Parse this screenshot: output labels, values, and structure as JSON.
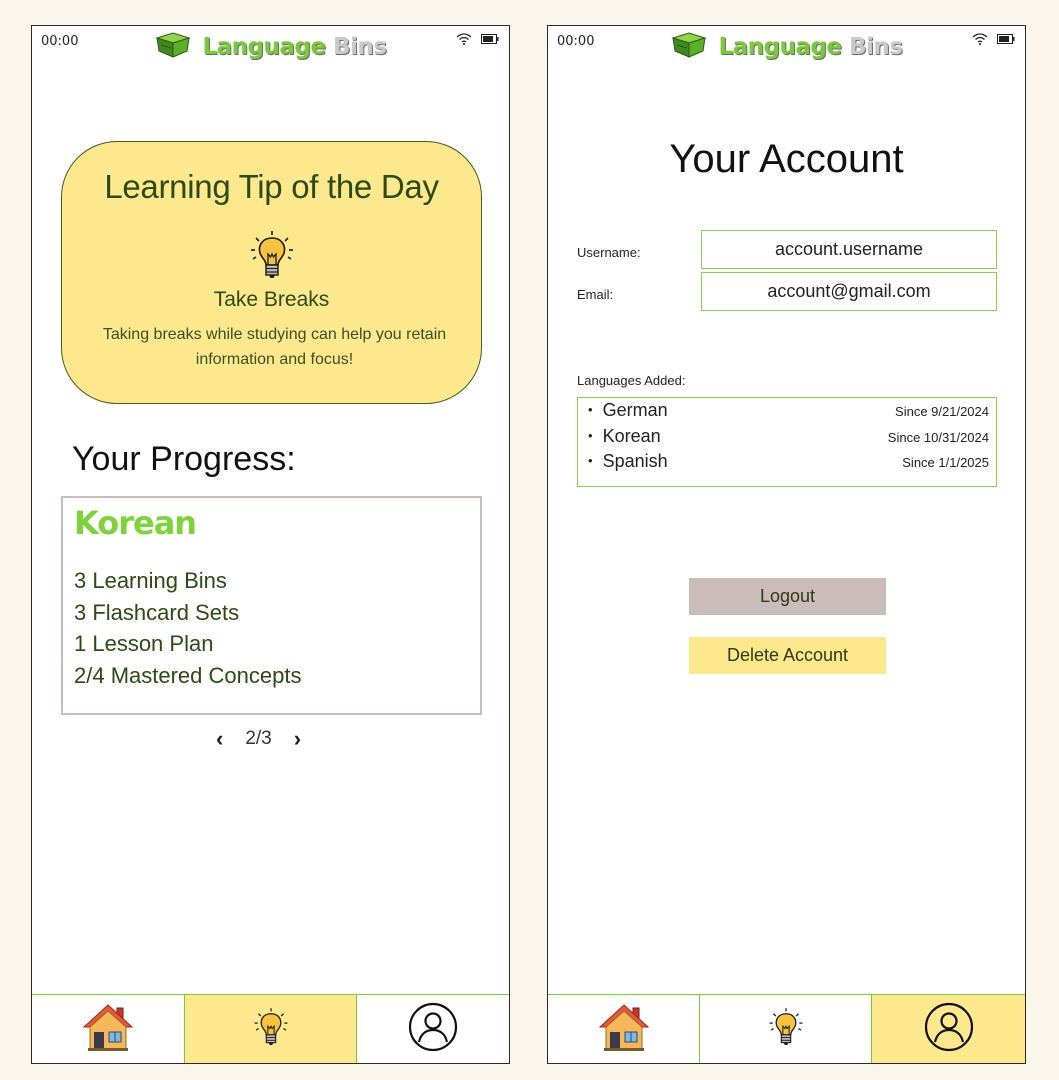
{
  "colors": {
    "brand_green": "#7ac93a",
    "accent_yellow": "#fde88e",
    "muted_rose": "#cbbcbc",
    "background": "#fbf6ec"
  },
  "status_bar": {
    "time": "00:00",
    "icons": [
      "wifi-icon",
      "battery-icon"
    ]
  },
  "brand": {
    "word1": "Language",
    "word2": "Bins",
    "logo_icon": "green-bin-icon"
  },
  "home_screen": {
    "tip": {
      "heading": "Learning Tip of the Day",
      "icon": "lightbulb-icon",
      "title": "Take Breaks",
      "text": "Taking breaks while studying can help you retain information and focus!"
    },
    "progress": {
      "heading": "Your Progress:",
      "language": "Korean",
      "stats": [
        "3 Learning Bins",
        "3 Flashcard Sets",
        "1 Lesson Plan",
        "2/4 Mastered Concepts"
      ],
      "pager": {
        "prev": "‹",
        "label": "2/3",
        "next": "›"
      }
    },
    "active_tab": "tip"
  },
  "account_screen": {
    "title": "Your Account",
    "username_label": "Username:",
    "username_value": "account.username",
    "email_label": "Email:",
    "email_value": "account@gmail.com",
    "languages_label": "Languages Added:",
    "languages": [
      {
        "name": "German",
        "since": "Since 9/21/2024"
      },
      {
        "name": "Korean",
        "since": "Since 10/31/2024"
      },
      {
        "name": "Spanish",
        "since": "Since 1/1/2025"
      }
    ],
    "logout_label": "Logout",
    "delete_label": "Delete Account",
    "active_tab": "account"
  },
  "bottom_nav": {
    "items": [
      {
        "id": "home",
        "icon": "house-icon"
      },
      {
        "id": "tip",
        "icon": "lightbulb-icon"
      },
      {
        "id": "account",
        "icon": "user-circle-icon"
      }
    ]
  }
}
